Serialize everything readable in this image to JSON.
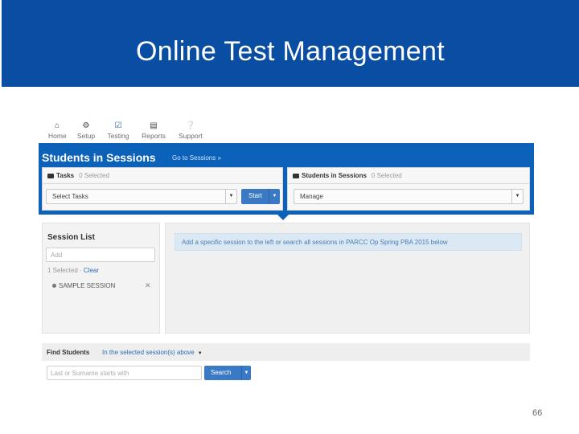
{
  "slide": {
    "title": "Online Test Management",
    "page_number": "66"
  },
  "nav": {
    "items": [
      {
        "label": "Home",
        "icon": "home-icon"
      },
      {
        "label": "Setup",
        "icon": "gear-icon"
      },
      {
        "label": "Testing",
        "icon": "checkbox-icon"
      },
      {
        "label": "Reports",
        "icon": "reports-icon"
      },
      {
        "label": "Support",
        "icon": "help-icon"
      }
    ],
    "active": "Testing"
  },
  "header": {
    "title": "Students in Sessions",
    "go_to_sessions": "Go to Sessions »"
  },
  "tasks_panel": {
    "title": "Tasks",
    "selected": "0 Selected",
    "select_value": "Select Tasks",
    "start_label": "Start"
  },
  "students_panel": {
    "title": "Students in Sessions",
    "selected": "0 Selected",
    "select_value": "Manage"
  },
  "session_list": {
    "title": "Session List",
    "input_placeholder": "Add",
    "selected_count": "1 Selected",
    "separator": " · ",
    "clear_label": "Clear",
    "items": [
      {
        "label": "SAMPLE SESSION"
      }
    ]
  },
  "main": {
    "info_message": "Add a specific session to the left or search all sessions in PARCC Op Spring PBA 2015 below"
  },
  "find_students": {
    "label": "Find Students",
    "scope": "In the selected session(s) above",
    "input_placeholder": "Last or Surname starts with",
    "search_label": "Search"
  },
  "colors": {
    "title_bar": "#0a4ea3",
    "header_band": "#0b62b8",
    "button": "#3a79c4",
    "info_bar": "#dbe9f5"
  }
}
